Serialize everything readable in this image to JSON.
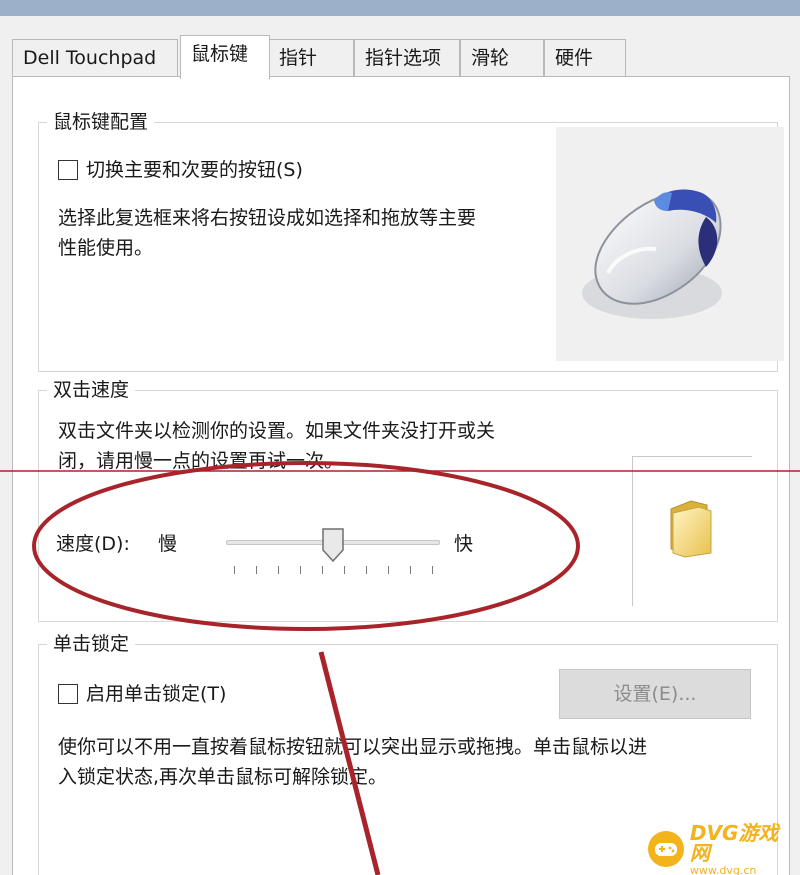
{
  "tabs": [
    {
      "label": "Dell Touchpad"
    },
    {
      "label": "鼠标键"
    },
    {
      "label": "指针"
    },
    {
      "label": "指针选项"
    },
    {
      "label": "滑轮"
    },
    {
      "label": "硬件"
    }
  ],
  "active_tab": "鼠标键",
  "button_config": {
    "title": "鼠标键配置",
    "checkbox_label": "切换主要和次要的按钮(S)",
    "checked": false,
    "desc_line1": "选择此复选框来将右按钮设成如选择和拖放等主要",
    "desc_line2": "性能使用。"
  },
  "double_click": {
    "title": "双击速度",
    "desc_line1": "双击文件夹以检测你的设置。如果文件夹没打开或关",
    "desc_line2": "闭，请用慢一点的设置再试一次。",
    "speed_label": "速度(D):",
    "slow_label": "慢",
    "fast_label": "快",
    "speed_level": 0.5
  },
  "click_lock": {
    "title": "单击锁定",
    "checkbox_label": "启用单击锁定(T)",
    "checked": false,
    "settings_button": "设置(E)...",
    "desc_line1": "使你可以不用一直按着鼠标按钮就可以突出显示或拖拽。单击鼠标以进",
    "desc_line2": "入锁定状态,再次单击鼠标可解除锁定。"
  },
  "watermark": {
    "brand": "DVG游戏网",
    "domain": "www.dvg.cn"
  },
  "colors": {
    "annotation_red": "#a8242b",
    "watermark_gold": "#f2b31b",
    "titlebar": "#9db0c9"
  },
  "icons": [
    "mouse-illustration-icon",
    "folder-icon",
    "gamepad-icon"
  ]
}
